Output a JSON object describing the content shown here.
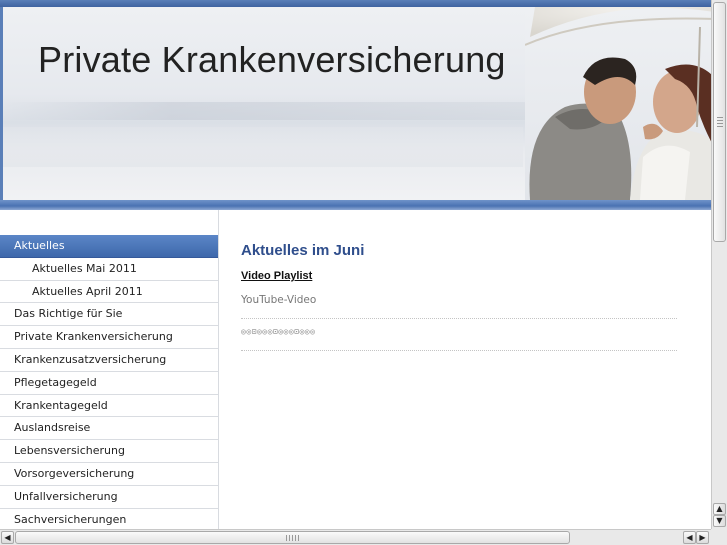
{
  "header": {
    "title": "Private Krankenversicherung"
  },
  "sidebar": {
    "items": [
      {
        "label": "Aktuelles",
        "active": true,
        "sub": false
      },
      {
        "label": "Aktuelles Mai 2011",
        "active": false,
        "sub": true
      },
      {
        "label": "Aktuelles April 2011",
        "active": false,
        "sub": true
      },
      {
        "label": "Das Richtige für Sie",
        "active": false,
        "sub": false
      },
      {
        "label": "Private Krankenversicherung",
        "active": false,
        "sub": false
      },
      {
        "label": "Krankenzusatzversicherung",
        "active": false,
        "sub": false
      },
      {
        "label": "Pflegetagegeld",
        "active": false,
        "sub": false
      },
      {
        "label": "Krankentagegeld",
        "active": false,
        "sub": false
      },
      {
        "label": "Auslandsreise",
        "active": false,
        "sub": false
      },
      {
        "label": "Lebensversicherung",
        "active": false,
        "sub": false
      },
      {
        "label": "Vorsorgeversicherung",
        "active": false,
        "sub": false
      },
      {
        "label": "Unfallversicherung",
        "active": false,
        "sub": false
      },
      {
        "label": "Sachversicherungen",
        "active": false,
        "sub": false
      }
    ]
  },
  "main": {
    "title": "Aktuelles im Juni",
    "video_link": "Video Playlist",
    "video_sub": "YouTube-Video",
    "glyph_row": "◎◎⊡◎◎◎⊡◎◎◎⊡◎◎◎"
  },
  "scrollbars": {
    "up_icon": "▲",
    "down_icon": "▼",
    "left_icon": "◀",
    "right_icon": "▶"
  },
  "colors": {
    "accent": "#3e68ab",
    "title_blue": "#2f4e8c"
  }
}
